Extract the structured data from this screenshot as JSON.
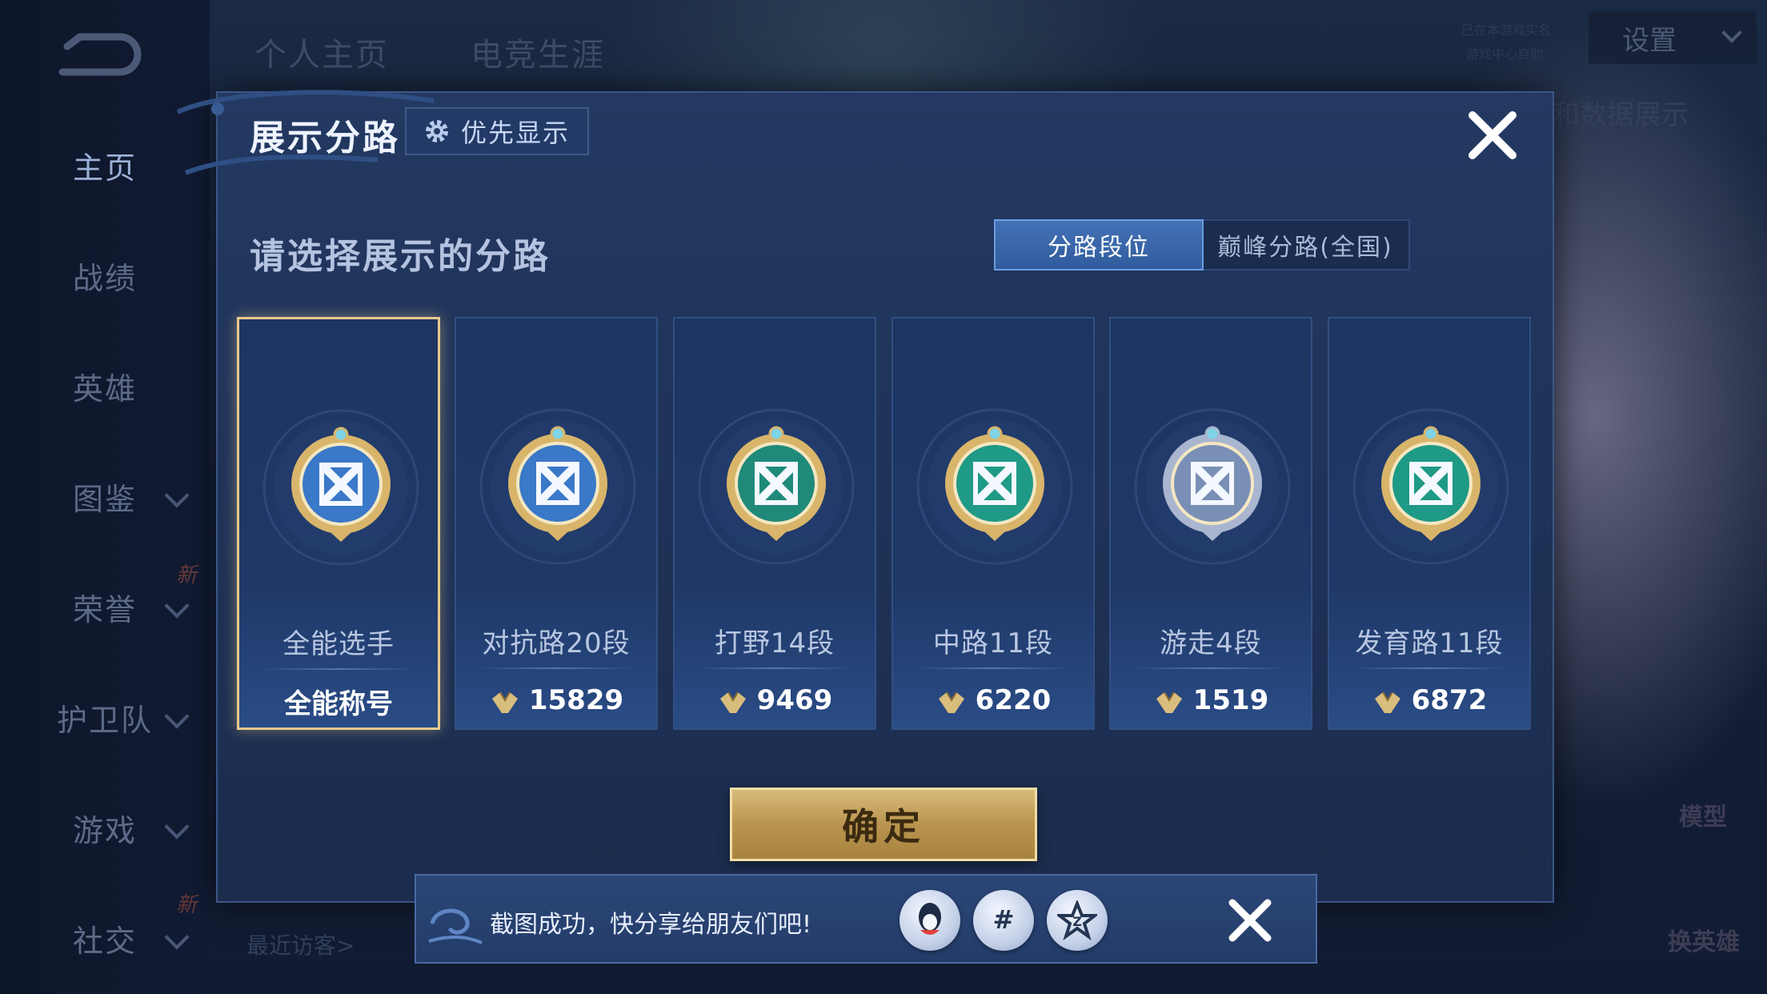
{
  "background": {
    "tabs": [
      "个人主页",
      "电竞生涯"
    ],
    "settings_label": "设置",
    "right_label": "和数据展示",
    "recent_visitors": "最近访客>",
    "model_label": "模型",
    "switch_hero_label": "换英雄",
    "top_right_hint_1": "已在本游戏实名",
    "top_right_hint_2": "游戏中心自助"
  },
  "sidebar": {
    "items": [
      {
        "label": "主页",
        "has_chevron": false
      },
      {
        "label": "战绩",
        "has_chevron": false
      },
      {
        "label": "英雄",
        "has_chevron": false
      },
      {
        "label": "图鉴",
        "has_chevron": true
      },
      {
        "label": "荣誉",
        "has_chevron": true
      },
      {
        "label": "护卫队",
        "has_chevron": true
      },
      {
        "label": "游戏",
        "has_chevron": true
      },
      {
        "label": "社交",
        "has_chevron": true
      }
    ],
    "new_badge": "新"
  },
  "modal": {
    "title": "展示分路",
    "priority_button": "优先显示",
    "subtitle": "请选择展示的分路",
    "segments": [
      "分路段位",
      "巅峰分路(全国)"
    ],
    "active_segment": 0,
    "cards": [
      {
        "lane": "全能选手",
        "score": "全能称号",
        "has_score_icon": false,
        "selected": true,
        "icon": "all-round-medal",
        "accent": "#3a78c8"
      },
      {
        "lane": "对抗路20段",
        "score": "15829",
        "has_score_icon": true,
        "selected": false,
        "icon": "clash-lane-medal",
        "accent": "#3a78c8"
      },
      {
        "lane": "打野14段",
        "score": "9469",
        "has_score_icon": true,
        "selected": false,
        "icon": "jungle-medal",
        "accent": "#1f8a7a"
      },
      {
        "lane": "中路11段",
        "score": "6220",
        "has_score_icon": true,
        "selected": false,
        "icon": "mid-lane-medal",
        "accent": "#1f9a86"
      },
      {
        "lane": "游走4段",
        "score": "1519",
        "has_score_icon": true,
        "selected": false,
        "icon": "roam-medal",
        "accent": "#7a8fb6"
      },
      {
        "lane": "发育路11段",
        "score": "6872",
        "has_score_icon": true,
        "selected": false,
        "icon": "farm-lane-medal",
        "accent": "#1f9a86"
      }
    ],
    "confirm_label": "确定"
  },
  "toast": {
    "message": "截图成功，快分享给朋友们吧!",
    "icons": [
      "qq-icon",
      "wechat-moments-icon",
      "qzone-icon"
    ]
  },
  "colors": {
    "gold": "#e6c98b",
    "panel": "#233961",
    "accent_blue": "#4472b6"
  }
}
